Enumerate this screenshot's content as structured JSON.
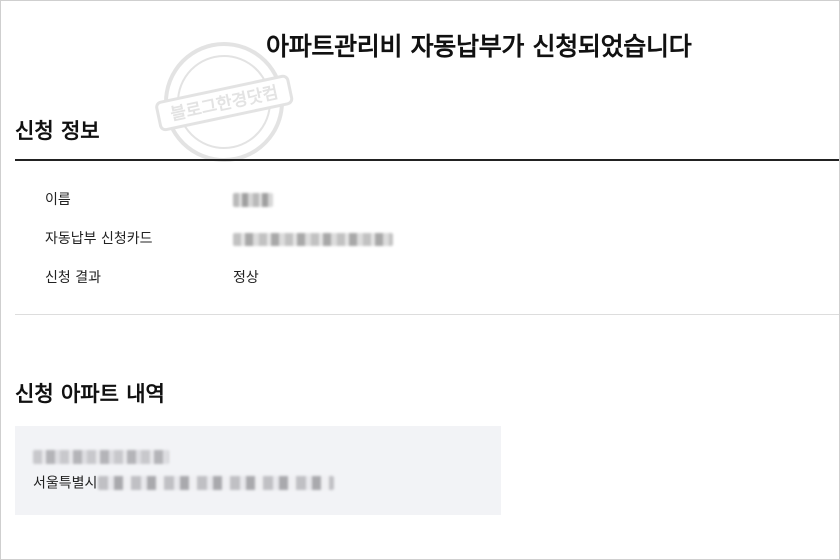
{
  "header": {
    "success_title": "아파트관리비 자동납부가 신청되었습니다"
  },
  "watermark": {
    "text": "블로그한경닷컴",
    "icon": "circular-stamp-watermark"
  },
  "application_info": {
    "heading": "신청 정보",
    "rows": [
      {
        "label": "이름",
        "value": "",
        "masked": true
      },
      {
        "label": "자동납부 신청카드",
        "value": "",
        "masked": true
      },
      {
        "label": "신청 결과",
        "value": "정상",
        "masked": false
      }
    ]
  },
  "apartment_list": {
    "heading": "신청 아파트 내역",
    "items": [
      {
        "name": "",
        "address_prefix": "서울특별시",
        "address_masked": true
      }
    ]
  },
  "colors": {
    "background": "#ffffff",
    "text": "#111111",
    "divider_dark": "#222222",
    "divider_light": "#dddddd",
    "box_background": "#f2f3f6"
  }
}
